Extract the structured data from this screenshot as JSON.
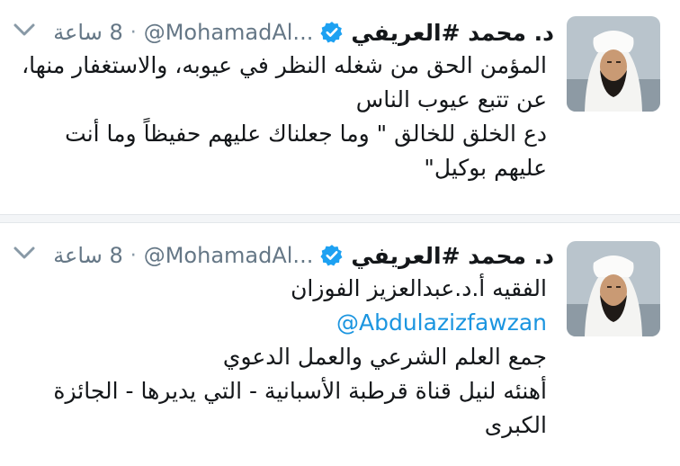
{
  "tweets": [
    {
      "name": "د. محمد #العريفي",
      "handle": "@MohamadAl...",
      "time": "8 ساعة",
      "lines": [
        "المؤمن الحق من شغله النظر في عيوبه، والاستغفار منها،",
        "عن تتبع عيوب الناس",
        "دع الخلق للخالق \" وما جعلناك عليهم حفيظاً وما أنت",
        "عليهم بوكيل\""
      ]
    },
    {
      "name": "د. محمد #العريفي",
      "handle": "@MohamadAl...",
      "time": "8 ساعة",
      "lines": [
        "الفقيه أ.د.عبدالعزيز الفوزان",
        "@Abdulazizfawzan",
        "جمع العلم الشرعي والعمل الدعوي",
        "أهنئه لنيل قناة قرطبة الأسبانية - التي يديرها - الجائزة",
        "الكبرى"
      ]
    }
  ],
  "colors": {
    "verified": "#1da1f2",
    "mention": "#1b95e0",
    "secondary": "#657786"
  },
  "icons": {
    "verified": "verified-badge-icon",
    "menu": "chevron-down-icon"
  }
}
